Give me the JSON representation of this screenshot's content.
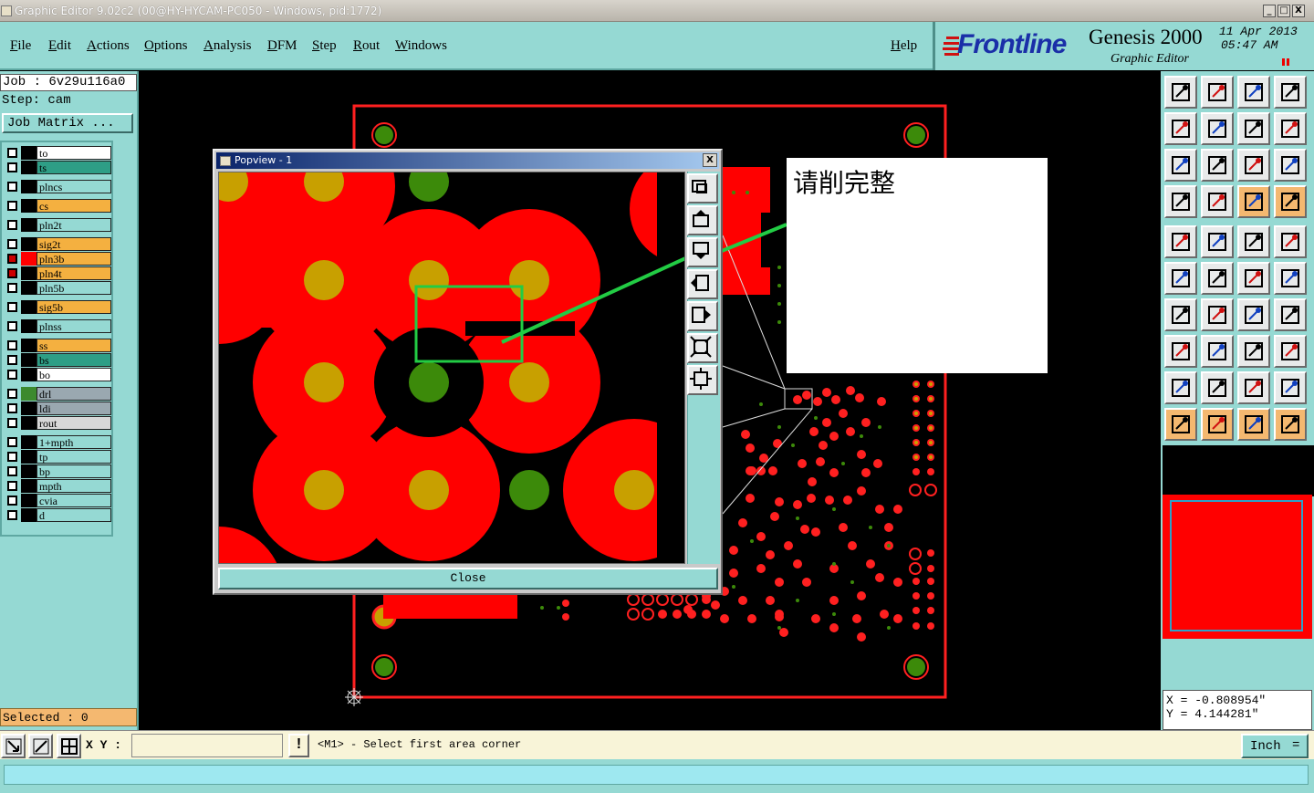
{
  "window": {
    "title": "Graphic Editor 9.02c2 (00@HY-HYCAM-PC050 - Windows, pid:1772)",
    "minimize": "_",
    "maximize": "□",
    "close": "X"
  },
  "menu": {
    "items": [
      "File",
      "Edit",
      "Actions",
      "Options",
      "Analysis",
      "DFM",
      "Step",
      "Rout",
      "Windows"
    ],
    "help": "Help"
  },
  "brand": {
    "logo": "Frontline",
    "product": "Genesis 2000",
    "subtitle": "Graphic Editor",
    "date": "11 Apr 2013",
    "time": "05:47 AM"
  },
  "job": {
    "job_line": "Job : 6v29u116a0",
    "step_line": "Step: cam",
    "matrix_button": "Job Matrix ..."
  },
  "layers": [
    {
      "name": "to",
      "color": "#ffffff",
      "swatch": "#000000"
    },
    {
      "name": "ts",
      "color": "#2e9e86",
      "swatch": "#000000"
    },
    {
      "name": "plncs",
      "color": "#95d9d3",
      "swatch": "#000000"
    },
    {
      "name": "cs",
      "color": "#f4b040",
      "swatch": "#000000"
    },
    {
      "name": "pln2t",
      "color": "#95d9d3",
      "swatch": "#000000"
    },
    {
      "name": "sig2t",
      "color": "#f4b040",
      "swatch": "#000000"
    },
    {
      "name": "pln3b",
      "color": "#f4b040",
      "swatch": "#ff0000",
      "active": true
    },
    {
      "name": "pln4t",
      "color": "#f4b040",
      "swatch": "#000000",
      "active": true
    },
    {
      "name": "pln5b",
      "color": "#95d9d3",
      "swatch": "#000000"
    },
    {
      "name": "sig5b",
      "color": "#f4b040",
      "swatch": "#000000"
    },
    {
      "name": "plnss",
      "color": "#95d9d3",
      "swatch": "#000000"
    },
    {
      "name": "ss",
      "color": "#f4b040",
      "swatch": "#000000"
    },
    {
      "name": "bs",
      "color": "#2e9e86",
      "swatch": "#000000"
    },
    {
      "name": "bo",
      "color": "#ffffff",
      "swatch": "#000000"
    },
    {
      "name": "drl",
      "color": "#9aa8b0",
      "swatch": "#3c8a2e"
    },
    {
      "name": "ldi",
      "color": "#9aa8b0",
      "swatch": "#000000"
    },
    {
      "name": "rout",
      "color": "#d8d8d8",
      "swatch": "#000000"
    },
    {
      "name": "1+mpth",
      "color": "#95d9d3",
      "swatch": "#000000"
    },
    {
      "name": "tp",
      "color": "#95d9d3",
      "swatch": "#000000"
    },
    {
      "name": "bp",
      "color": "#95d9d3",
      "swatch": "#000000"
    },
    {
      "name": "mpth",
      "color": "#95d9d3",
      "swatch": "#000000"
    },
    {
      "name": "cvia",
      "color": "#95d9d3",
      "swatch": "#000000"
    },
    {
      "name": "d",
      "color": "#95d9d3",
      "swatch": "#000000"
    }
  ],
  "selected": "Selected : 0",
  "popview": {
    "title": "Popview - 1",
    "close_x": "X",
    "close_button": "Close"
  },
  "note": {
    "text": "请削完整"
  },
  "coords": {
    "x": "X = -0.808954\"",
    "y": "Y = 4.144281\""
  },
  "status": {
    "xy_label": "X Y :",
    "xy_value": "",
    "message": "<M1> - Select first area corner",
    "units": "Inch",
    "units_arrow": "="
  },
  "colors": {
    "teal": "#95d9d3",
    "copper": "#ff0000",
    "pad": "#c8a000",
    "drill": "#3c8a0a",
    "selection": "#22cc22"
  }
}
